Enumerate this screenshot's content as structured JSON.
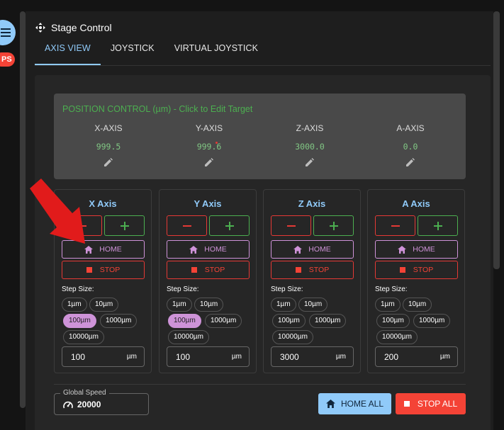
{
  "badge": {
    "text": "PS"
  },
  "panel": {
    "title": "Stage Control",
    "tabs": [
      {
        "label": "AXIS VIEW",
        "active": true
      },
      {
        "label": "JOYSTICK",
        "active": false
      },
      {
        "label": "VIRTUAL JOYSTICK",
        "active": false
      }
    ]
  },
  "position": {
    "title": "POSITION CONTROL (µm) - Click to Edit Target",
    "axes": [
      {
        "label": "X-AXIS",
        "value": "999.5"
      },
      {
        "label": "Y-AXIS",
        "value": "999.6"
      },
      {
        "label": "Z-AXIS",
        "value": "3000.0"
      },
      {
        "label": "A-AXIS",
        "value": "0.0"
      }
    ]
  },
  "axis_cards": [
    {
      "title": "X Axis",
      "home_label": "HOME",
      "stop_label": "STOP",
      "step_label": "Step Size:",
      "step_value": "100",
      "unit": "µm",
      "selected_step": "100µm"
    },
    {
      "title": "Y Axis",
      "home_label": "HOME",
      "stop_label": "STOP",
      "step_label": "Step Size:",
      "step_value": "100",
      "unit": "µm",
      "selected_step": "100µm"
    },
    {
      "title": "Z Axis",
      "home_label": "HOME",
      "stop_label": "STOP",
      "step_label": "Step Size:",
      "step_value": "3000",
      "unit": "µm",
      "selected_step": ""
    },
    {
      "title": "A Axis",
      "home_label": "HOME",
      "stop_label": "STOP",
      "step_label": "Step Size:",
      "step_value": "200",
      "unit": "µm",
      "selected_step": ""
    }
  ],
  "step_options": [
    "1µm",
    "10µm",
    "100µm",
    "1000µm",
    "10000µm"
  ],
  "global_speed": {
    "label": "Global Speed",
    "value": "20000"
  },
  "actions": {
    "home_all": "HOME ALL",
    "stop_all": "STOP ALL"
  },
  "colors": {
    "accent": "#90caf9",
    "success": "#4caf50",
    "danger": "#f44336",
    "home": "#ce93d8",
    "background": "#1e1e1e"
  },
  "icons": [
    "menu-icon",
    "move-icon",
    "edit-icon",
    "home-icon",
    "stop-icon",
    "speedometer-icon",
    "annotation-arrow"
  ]
}
